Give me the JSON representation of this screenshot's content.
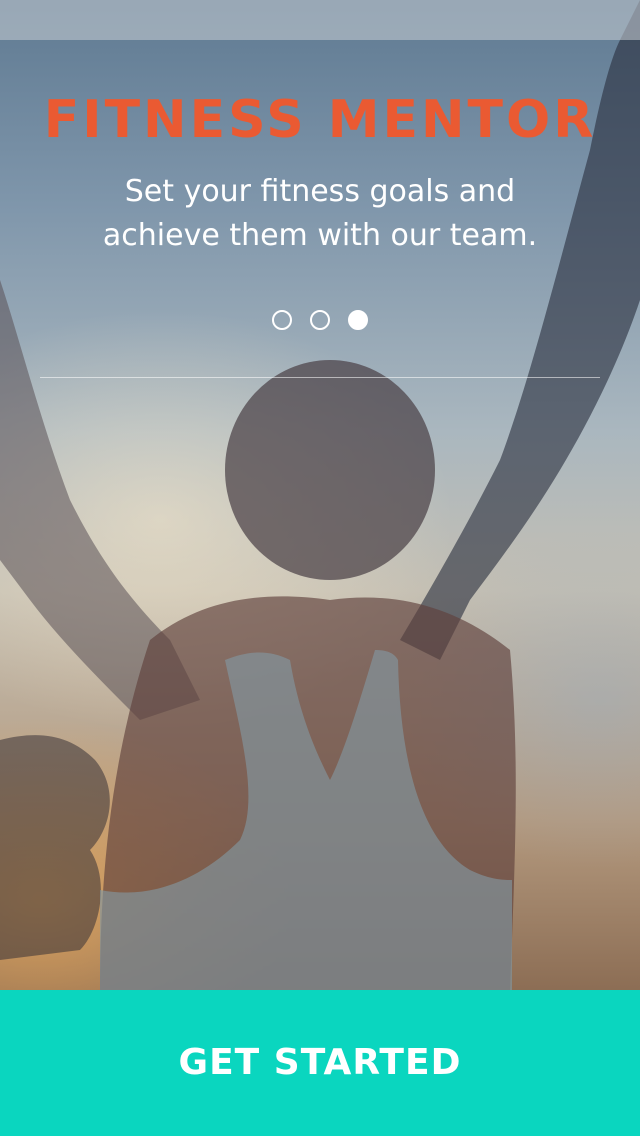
{
  "app": {
    "title": "FITNESS MENTOR",
    "tagline": "Set your fitness goals and achieve them with our team."
  },
  "pager": {
    "page_count": 3,
    "active_index": 2
  },
  "cta": {
    "label": "GET STARTED"
  },
  "colors": {
    "title": "#ea5a32",
    "cta_background": "#0ad6bf",
    "text": "#ffffff"
  },
  "background": {
    "subject": "woman-raising-arms-photo"
  }
}
